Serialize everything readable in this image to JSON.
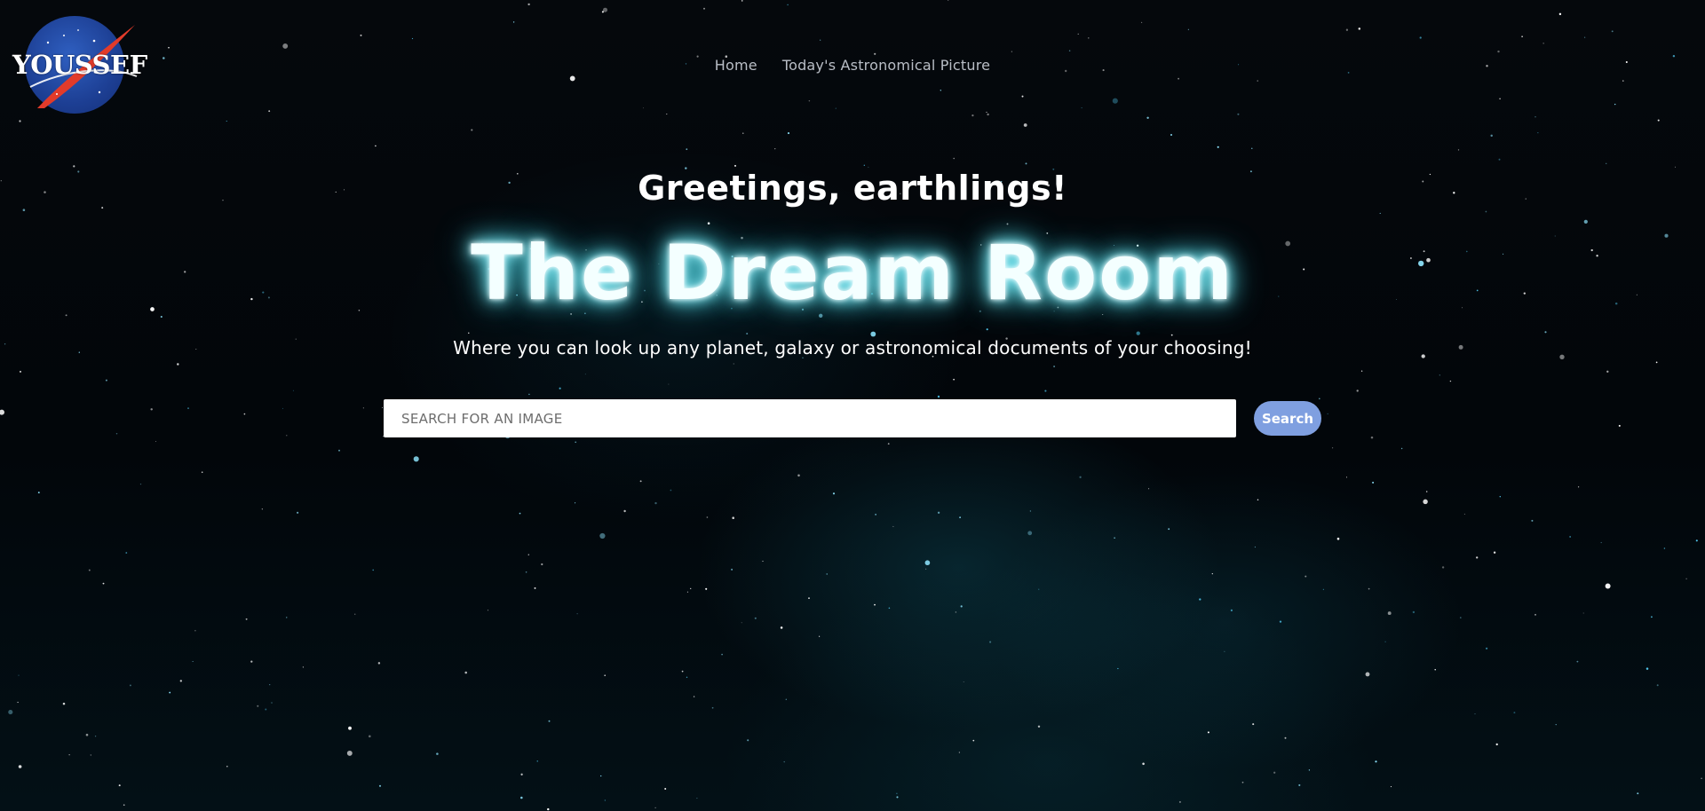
{
  "logo": {
    "text": "YOUSSEF",
    "icon": "nasa-style-meatball-logo"
  },
  "nav": {
    "items": [
      {
        "label": "Home"
      },
      {
        "label": "Today's Astronomical Picture"
      }
    ]
  },
  "hero": {
    "greeting": "Greetings, earthlings!",
    "title": "The Dream Room",
    "subtitle": "Where you can look up any planet, galaxy or astronomical documents of your choosing!"
  },
  "search": {
    "placeholder": "SEARCH FOR AN IMAGE",
    "value": "",
    "button_label": "Search"
  },
  "colors": {
    "background": "#02060a",
    "nebula": "#146e82",
    "title_glow": "#5fe3f0",
    "button": "#7f9fe0",
    "logo_blue": "#1d3f94",
    "logo_red": "#e23b2a"
  }
}
